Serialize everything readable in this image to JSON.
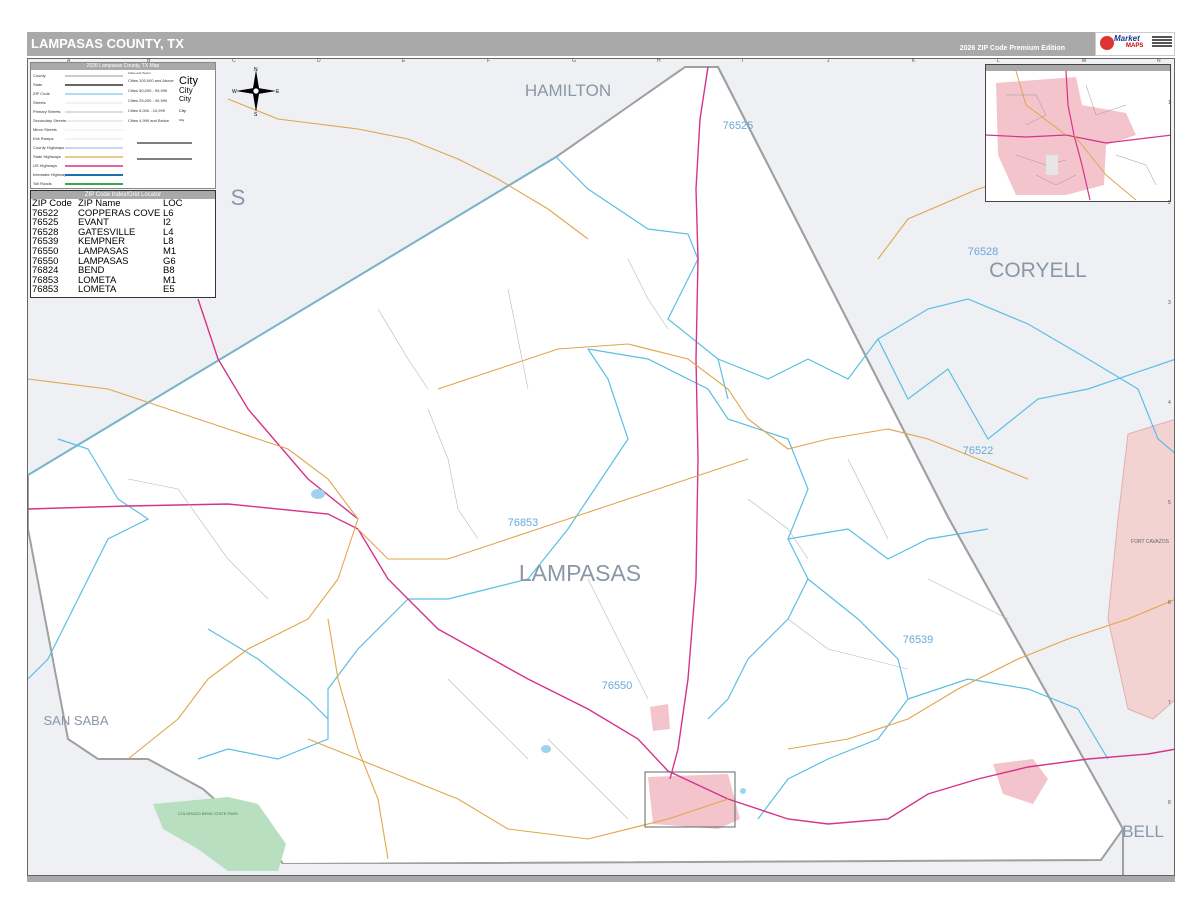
{
  "header": {
    "title": "LAMPASAS COUNTY, TX",
    "edition": "2026 ZIP Code Premium Edition",
    "logo_text_1": "Market",
    "logo_text_2": "MAPS"
  },
  "legend": {
    "title": "2026 Lampasas County, TX Map",
    "items": [
      "County",
      "State",
      "ZIP Code",
      "Streets",
      "Primary Streets",
      "Secondary Streets",
      "Minor Streets",
      "Exit Ramps",
      "County Highways",
      "State Highways",
      "US Highways",
      "Interstate Highways",
      "Toll Roads"
    ],
    "city_heading": "Cities and Towns",
    "cities": [
      {
        "range": "Cities 100,000 and Above",
        "label": "City"
      },
      {
        "range": "Cities 50,000 - 99,999",
        "label": "City"
      },
      {
        "range": "Cities 25,000 - 49,999",
        "label": "City"
      },
      {
        "range": "Cities 5,000 - 24,999",
        "label": "City"
      },
      {
        "range": "Cities 4,999 and Below",
        "label": "City"
      }
    ]
  },
  "compass": {
    "n": "N",
    "s": "S",
    "e": "E",
    "w": "W"
  },
  "zip_table": {
    "title": "ZIP Code Index/Grid Locator",
    "headers": [
      "ZIP Code",
      "ZIP Name",
      "LOC"
    ],
    "rows": [
      [
        "76522",
        "COPPERAS COVE",
        "L6"
      ],
      [
        "76525",
        "EVANT",
        "I2"
      ],
      [
        "76528",
        "GATESVILLE",
        "L4"
      ],
      [
        "76539",
        "KEMPNER",
        "L8"
      ],
      [
        "76550",
        "LAMPASAS",
        "M1"
      ],
      [
        "76550",
        "LAMPASAS",
        "G6"
      ],
      [
        "76824",
        "BEND",
        "B8"
      ],
      [
        "76853",
        "LOMETA",
        "M1"
      ],
      [
        "76853",
        "LOMETA",
        "E5"
      ]
    ]
  },
  "map_labels": {
    "county_main": "LAMPASAS",
    "hamilton": "HAMILTON",
    "coryell": "CORYELL",
    "san_saba": "SAN SABA",
    "bell": "BELL",
    "fort_cavazos": "FORT CAVAZOS",
    "park": "COLORADO BEND STATE PARK",
    "partial_s": "S"
  },
  "zip_labels": {
    "z76525": "76525",
    "z76528": "76528",
    "z76522": "76522",
    "z76853": "76853",
    "z76539": "76539",
    "z76550": "76550"
  },
  "grid": {
    "top": [
      "A",
      "B",
      "C",
      "D",
      "E",
      "F",
      "G",
      "H",
      "I",
      "J",
      "K",
      "L",
      "M",
      "N"
    ],
    "right": [
      "1",
      "2",
      "3",
      "4",
      "5",
      "6",
      "7",
      "8"
    ]
  },
  "colors": {
    "zip_boundary": "#5bbfe3",
    "county_boundary": "#a0a0a0",
    "us_highway": "#d6338a",
    "state_highway": "#e0a64a",
    "neighbor_fill": "#eef0f4",
    "urban_fill": "#f3c4cc",
    "park_fill": "#b7dfc0",
    "label_blue": "#6aa8d8"
  }
}
